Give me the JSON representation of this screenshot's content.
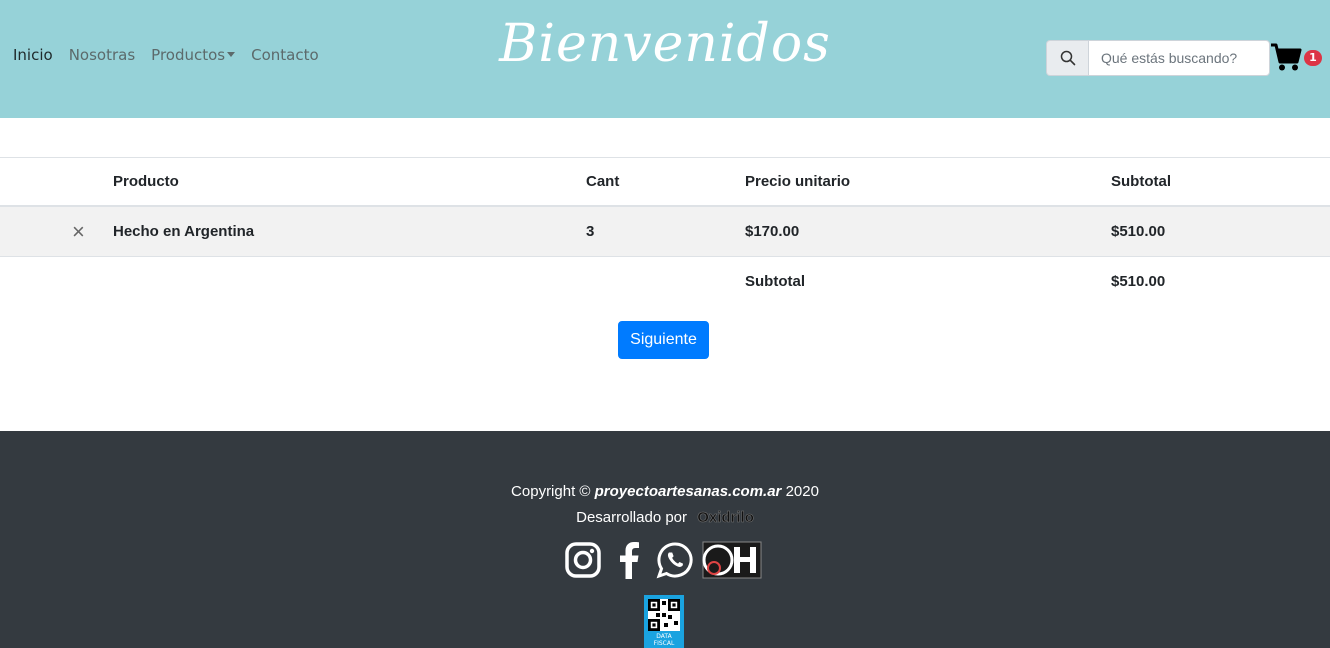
{
  "nav": {
    "items": [
      {
        "label": "Inicio"
      },
      {
        "label": "Nosotras"
      },
      {
        "label": "Productos"
      },
      {
        "label": "Contacto"
      }
    ]
  },
  "brand": {
    "title": "Bienvenidos"
  },
  "search": {
    "placeholder": "Qué estás buscando?",
    "icon": "search-icon"
  },
  "cart": {
    "icon": "cart-icon",
    "count": "1",
    "badge_color": "#dc3545"
  },
  "table": {
    "headers": {
      "product": "Producto",
      "qty": "Cant",
      "unit_price": "Precio unitario",
      "subtotal": "Subtotal"
    },
    "rows": [
      {
        "remove": "×",
        "product": "Hecho en Argentina",
        "qty": "3",
        "unit_price": "$170.00",
        "subtotal": "$510.00"
      }
    ],
    "total": {
      "label": "Subtotal",
      "value": "$510.00"
    }
  },
  "actions": {
    "next_label": "Siguiente",
    "next_color": "#007bff"
  },
  "footer": {
    "copyright_prefix": "Copyright ©",
    "site": "proyectoartesanas.com.ar",
    "year": "2020",
    "developed_by": "Desarrollado por",
    "developer": "Oxidrilo",
    "socials": [
      "instagram-icon",
      "facebook-icon",
      "whatsapp-icon",
      "oh-logo"
    ],
    "qr_text_1": "DATA",
    "qr_text_2": "FISCAL"
  },
  "colors": {
    "header_bg": "#96d2d8",
    "footer_bg": "#343a40"
  }
}
